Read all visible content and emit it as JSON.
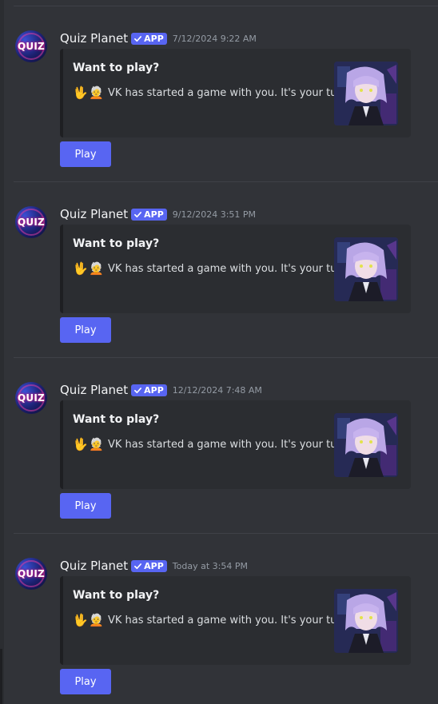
{
  "messages": [
    {
      "author": "Quiz Planet",
      "avatar_text": "QUIZ",
      "badge": "APP",
      "timestamp": "7/12/2024 9:22 AM",
      "embed_title": "Want to play?",
      "embed_description": "VK has started a game with you. It's your turn!",
      "emoji_1": "🖖",
      "emoji_2": "🧑‍🦳",
      "button_label": "Play"
    },
    {
      "author": "Quiz Planet",
      "avatar_text": "QUIZ",
      "badge": "APP",
      "timestamp": "9/12/2024 3:51 PM",
      "embed_title": "Want to play?",
      "embed_description": "VK has started a game with you. It's your turn!",
      "emoji_1": "🖖",
      "emoji_2": "🧑‍🦳",
      "button_label": "Play"
    },
    {
      "author": "Quiz Planet",
      "avatar_text": "QUIZ",
      "badge": "APP",
      "timestamp": "12/12/2024 7:48 AM",
      "embed_title": "Want to play?",
      "embed_description": "VK has started a game with you. It's your turn!",
      "emoji_1": "🖖",
      "emoji_2": "🧑‍🦳",
      "button_label": "Play"
    },
    {
      "author": "Quiz Planet",
      "avatar_text": "QUIZ",
      "badge": "APP",
      "timestamp": "Today at 3:54 PM",
      "embed_title": "Want to play?",
      "embed_description": "VK has started a game with you. It's your turn!",
      "emoji_1": "🖖",
      "emoji_2": "🧑‍🦳",
      "button_label": "Play"
    }
  ],
  "colors": {
    "background": "#313338",
    "embed_background": "#2b2d31",
    "accent": "#5865f2",
    "timestamp": "#949ba4"
  },
  "icons": {
    "badge_icon": "checkmark-icon",
    "emoji_1": "vulcan-salute-icon",
    "emoji_2": "person-icon",
    "thumbnail": "anime-character-thumbnail"
  }
}
